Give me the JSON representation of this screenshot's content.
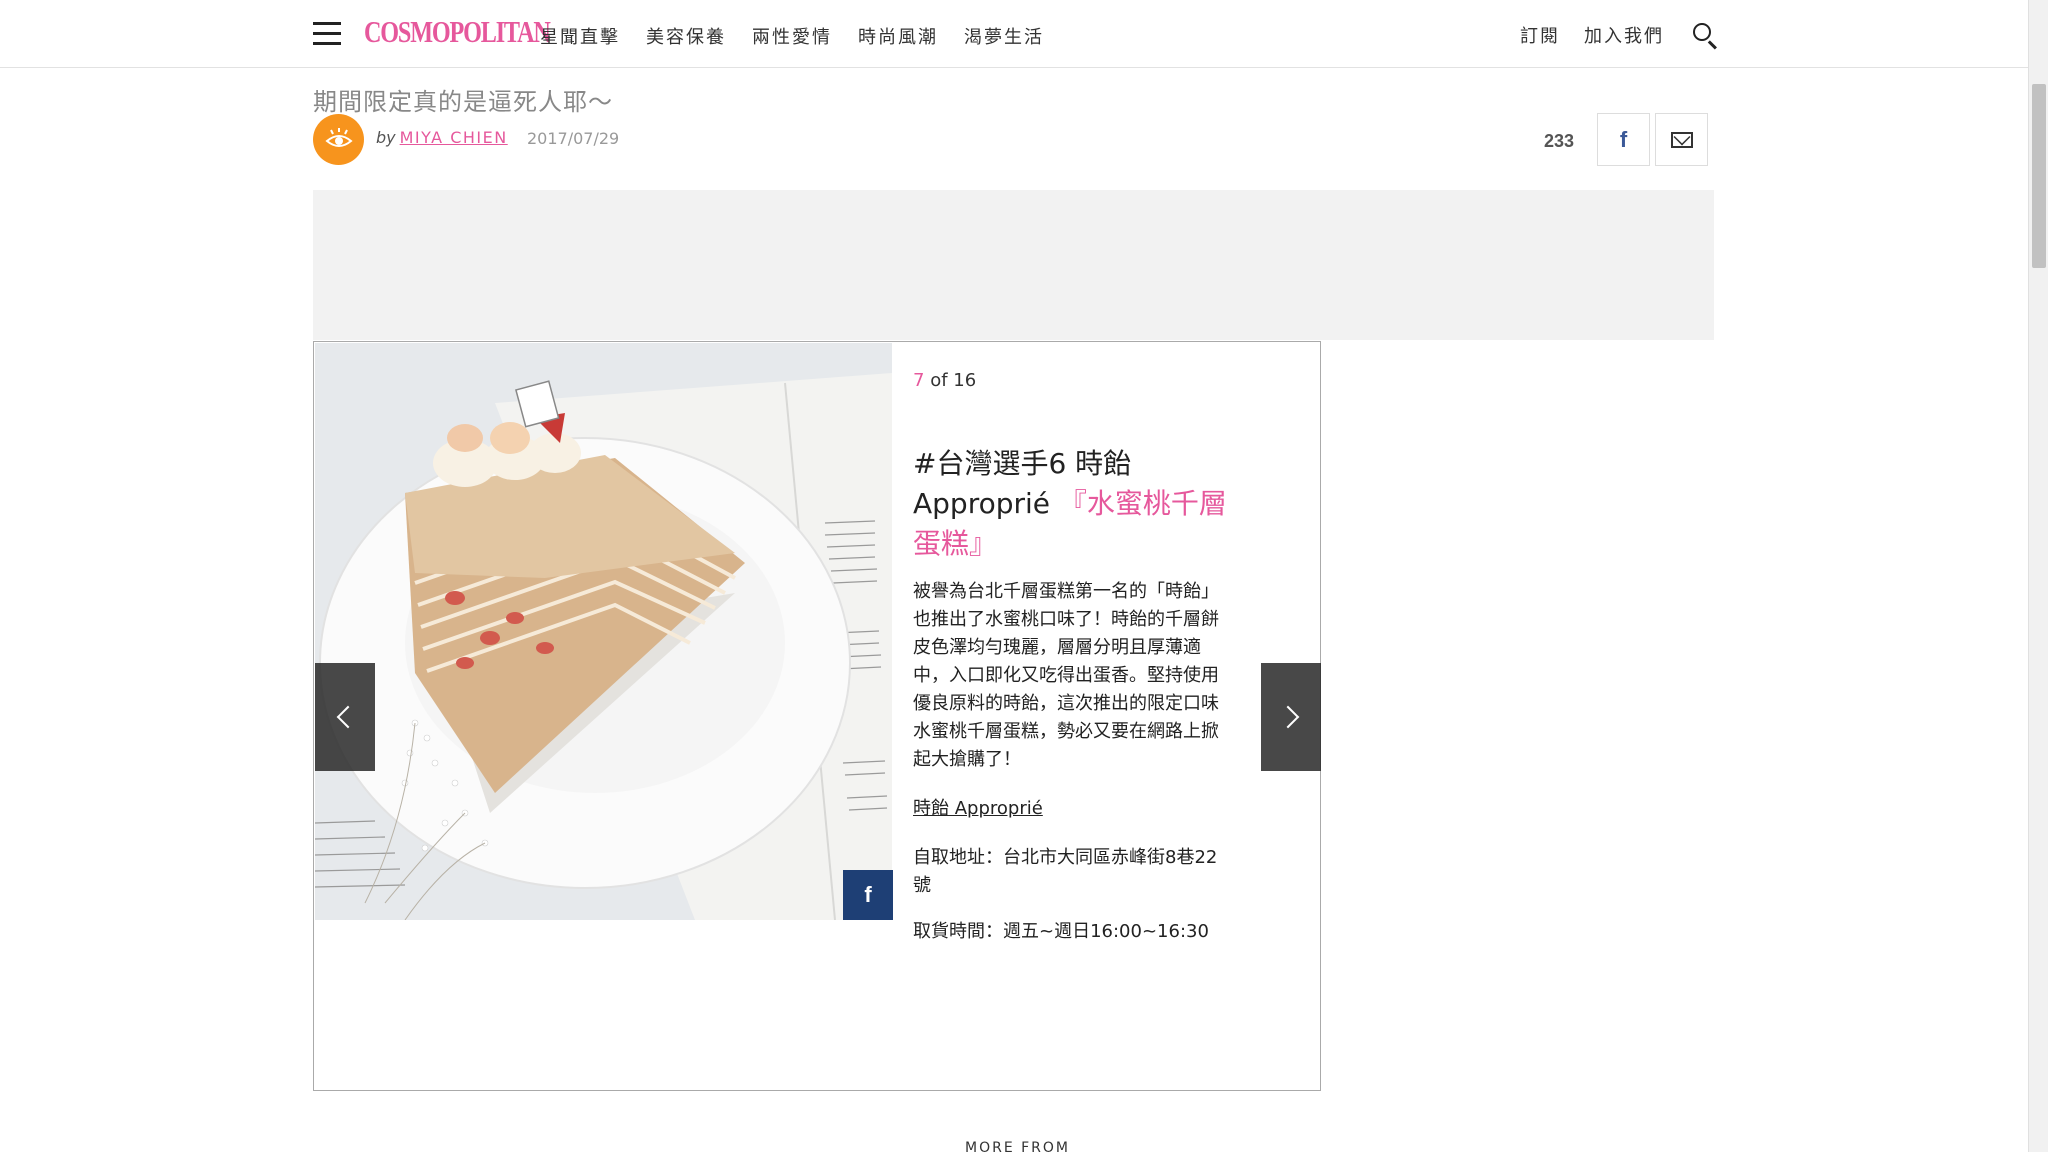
{
  "nav": {
    "logo": "COSMOPOLITAN",
    "links": [
      "星聞直擊",
      "美容保養",
      "兩性愛情",
      "時尚風潮",
      "渴夢生活"
    ],
    "subscribe": "訂閱",
    "join": "加入我們"
  },
  "article": {
    "subtitle": "期間限定真的是逼死人耶～",
    "by": "by",
    "author": "MIYA CHIEN",
    "date": "2017/07/29",
    "share_count": "233"
  },
  "gallery": {
    "current": "7",
    "of": "of 16",
    "title_plain": "#台灣選手6 時飴 Approprié ",
    "title_highlight": "『水蜜桃千層蛋糕』",
    "body": "被譽為台北千層蛋糕第一名的「時飴」也推出了水蜜桃口味了！時飴的千層餅皮色澤均勻瑰麗，層層分明且厚薄適中，入口即化又吃得出蛋香。堅持使用優良原料的時飴，這次推出的限定口味水蜜桃千層蛋糕，勢必又要在網路上掀起大搶購了！",
    "link": "時飴 Approprié",
    "address": "自取地址：台北市大同區赤峰街8巷22號",
    "hours": "取貨時間：週五~週日16:00~16:30"
  },
  "footer": {
    "more_from": "MORE FROM"
  },
  "icons": {
    "menu": "hamburger-menu-icon",
    "search": "search-icon",
    "avatar": "eye-icon",
    "facebook": "facebook-icon",
    "mail": "mail-icon",
    "prev": "chevron-left-icon",
    "next": "chevron-right-icon"
  },
  "colors": {
    "brand": "#e6589c",
    "avatar": "#f7941d",
    "facebook": "#1e3f75"
  }
}
